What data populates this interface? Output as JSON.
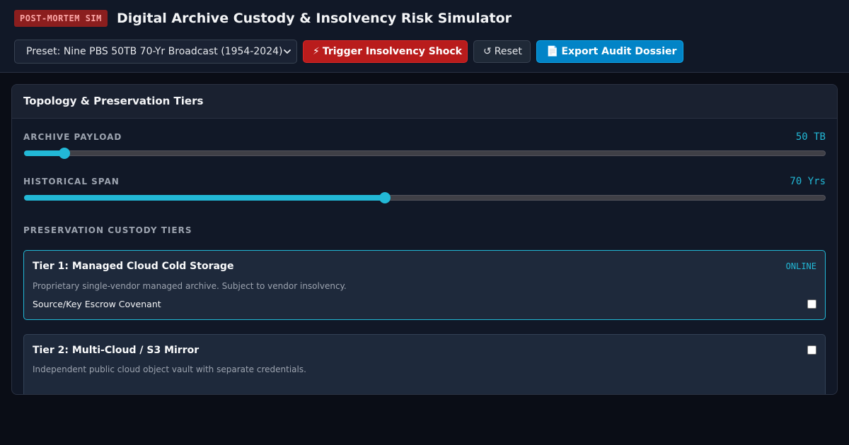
{
  "header": {
    "badge": "POST-MORTEM SIM",
    "title": "Digital Archive Custody & Insolvency Risk Simulator"
  },
  "toolbar": {
    "preset_selected": "Preset: Nine PBS 50TB 70-Yr Broadcast (1954-2024)",
    "shock_icon": "⚡",
    "shock_label": "Trigger Insolvency Shock",
    "reset_icon": "↺",
    "reset_label": "Reset",
    "export_icon": "📄",
    "export_label": "Export Audit Dossier"
  },
  "panel": {
    "title": "Topology & Preservation Tiers",
    "payload": {
      "label": "ARCHIVE PAYLOAD",
      "value": "50 TB",
      "fill_fraction": 0.05
    },
    "span": {
      "label": "HISTORICAL SPAN",
      "value": "70 Yrs",
      "fill_fraction": 0.45
    },
    "tiers_label": "PRESERVATION CUSTODY TIERS",
    "tiers": [
      {
        "title": "Tier 1: Managed Cloud Cold Storage",
        "status": "ONLINE",
        "description": "Proprietary single-vendor managed archive. Subject to vendor insolvency.",
        "option_label": "Source/Key Escrow Covenant",
        "option_checked": false
      },
      {
        "title": "Tier 2: Multi-Cloud / S3 Mirror",
        "description": "Independent public cloud object vault with separate credentials.",
        "checked": false
      }
    ]
  },
  "colors": {
    "accent": "#22b8d6",
    "danger": "#b91c1c",
    "primary": "#0284c7",
    "background": "#0a0d16"
  }
}
